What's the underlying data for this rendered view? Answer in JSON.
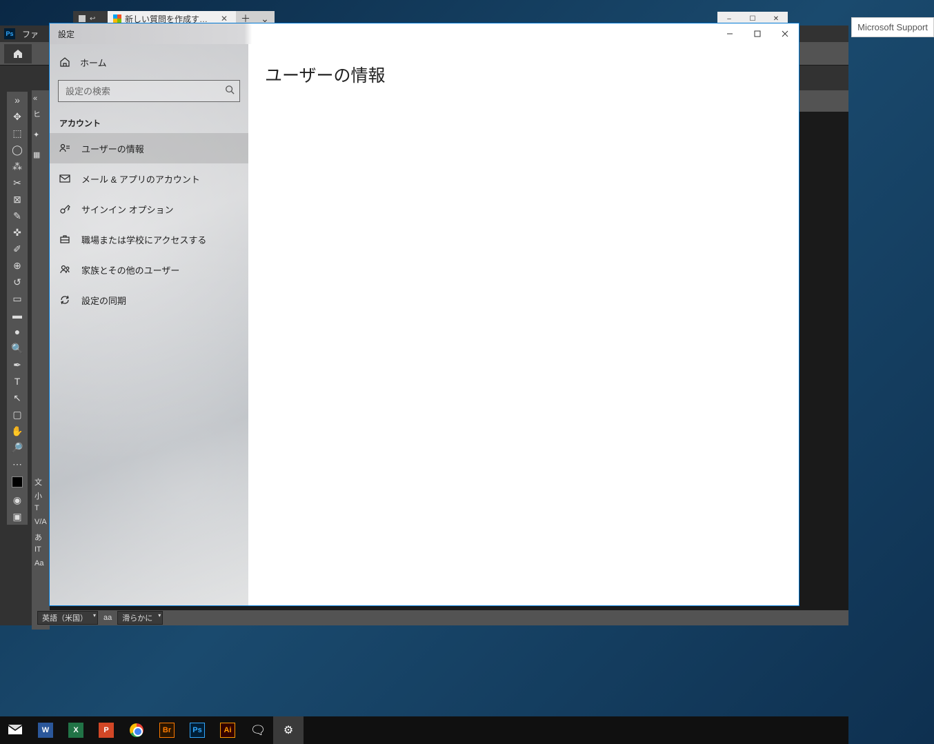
{
  "browser": {
    "tab_title": "新しい質問を作成する  ま",
    "ms_support": "Microsoft Support"
  },
  "edge_controls": {
    "minimize": "–",
    "maximize": "☐",
    "close": "✕"
  },
  "photoshop": {
    "menu_file": "ファ",
    "panel_history": "ヒ",
    "panel_char": "文",
    "panel_small": "小",
    "char_T": "T",
    "char_VA": "V/A",
    "char_a": "あ",
    "char_IT": "IT",
    "char_Aa": "Aa",
    "lang_label": "英語（米国）",
    "aa_label": "aa",
    "smooth_label": "滑らかに"
  },
  "settings": {
    "window_title": "設定",
    "home_label": "ホーム",
    "search_placeholder": "設定の検索",
    "section_header": "アカウント",
    "nav": [
      {
        "label": "ユーザーの情報"
      },
      {
        "label": "メール & アプリのアカウント"
      },
      {
        "label": "サインイン オプション"
      },
      {
        "label": "職場または学校にアクセスする"
      },
      {
        "label": "家族とその他のユーザー"
      },
      {
        "label": "設定の同期"
      }
    ],
    "main_heading": "ユーザーの情報"
  },
  "taskbar": {
    "word": "W",
    "excel": "X",
    "ppt": "P",
    "bridge": "Br",
    "photoshop": "Ps",
    "illustrator": "Ai"
  }
}
